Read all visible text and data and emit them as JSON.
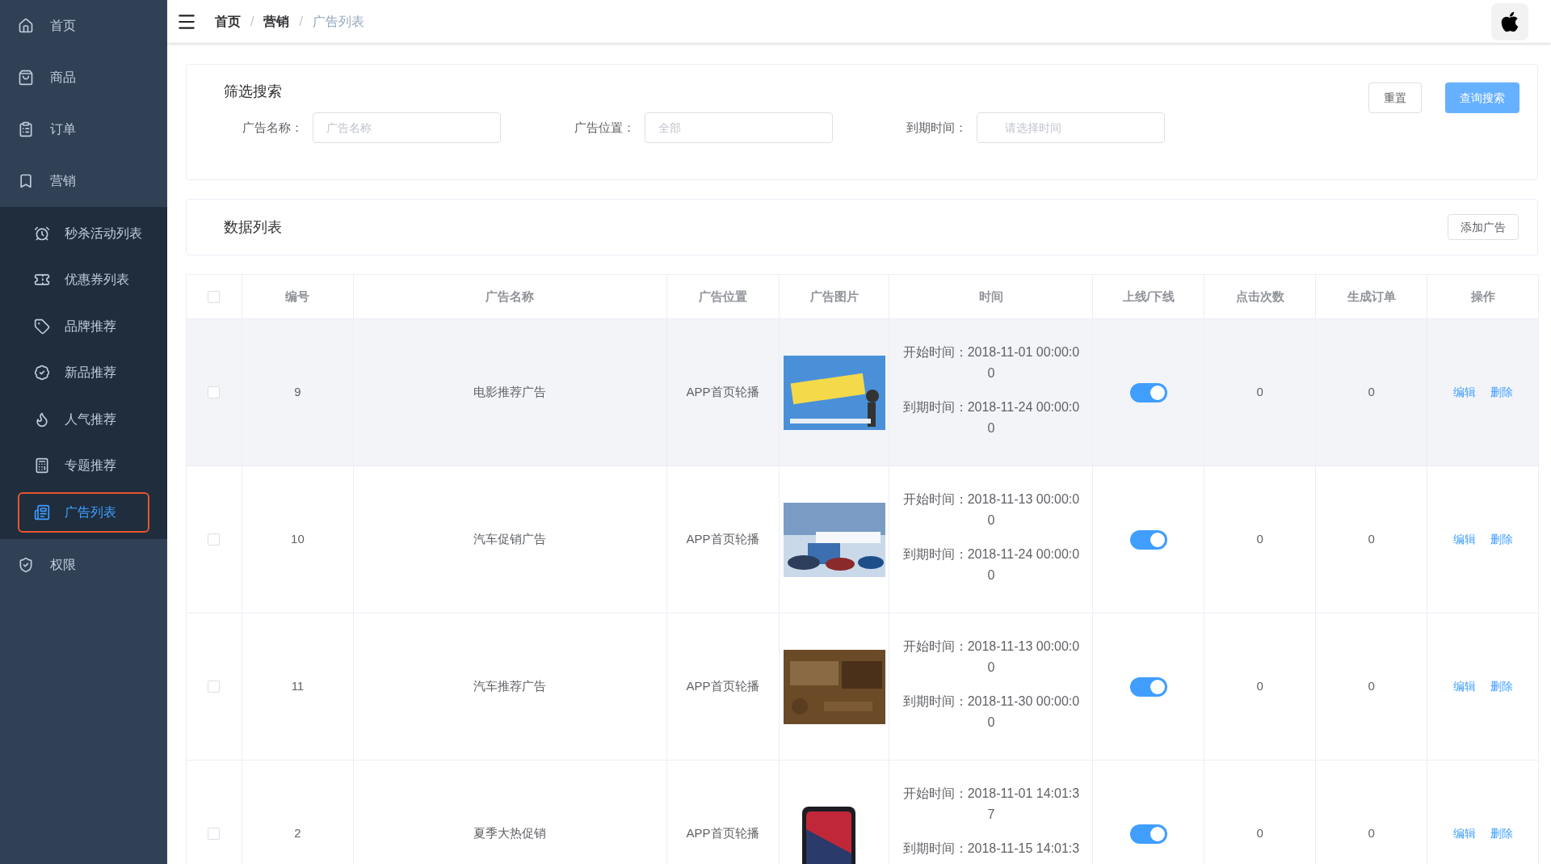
{
  "sidebar": {
    "items": [
      {
        "label": "首页",
        "kind": "home",
        "selected": false
      },
      {
        "label": "商品",
        "kind": "bag",
        "selected": false
      },
      {
        "label": "订单",
        "kind": "order",
        "selected": false
      },
      {
        "label": "营销",
        "kind": "mark",
        "selected": false,
        "expanded": true,
        "children": [
          {
            "label": "秒杀活动列表",
            "kind": "alarm",
            "selected": false
          },
          {
            "label": "优惠券列表",
            "kind": "ticket",
            "selected": false
          },
          {
            "label": "品牌推荐",
            "kind": "tag",
            "selected": false
          },
          {
            "label": "新品推荐",
            "kind": "new",
            "selected": false
          },
          {
            "label": "人气推荐",
            "kind": "flame",
            "selected": false
          },
          {
            "label": "专题推荐",
            "kind": "calc",
            "selected": false
          },
          {
            "label": "广告列表",
            "kind": "ad",
            "selected": true
          }
        ]
      },
      {
        "label": "权限",
        "kind": "shield",
        "selected": false
      }
    ]
  },
  "breadcrumb": [
    {
      "label": "首页",
      "kind": "link"
    },
    {
      "label": "/",
      "kind": "separator"
    },
    {
      "label": "营销",
      "kind": "link"
    },
    {
      "label": "/",
      "kind": "separator"
    },
    {
      "label": "广告列表",
      "kind": "current"
    }
  ],
  "filter": {
    "title": "筛选搜索",
    "reset": "重置",
    "search": "查询搜索",
    "fields": [
      {
        "label": "广告名称：",
        "placeholder": "广告名称"
      },
      {
        "label": "广告位置：",
        "placeholder": "全部"
      },
      {
        "label": "到期时间：",
        "placeholder": "请选择时间"
      }
    ]
  },
  "list": {
    "title": "数据列表",
    "add": "添加广告"
  },
  "table": {
    "select_all": {
      "checked": false
    },
    "columns": [
      "编号",
      "广告名称",
      "广告位置",
      "广告图片",
      "时间",
      "上线/下线",
      "点击次数",
      "生成订单",
      "操作"
    ],
    "rows": [
      {
        "checked": false,
        "hovered": true,
        "id": "9",
        "name": "电影推荐广告",
        "position": "APP首页轮播",
        "start": "开始时间：2018-11-01 00:00:00",
        "end": "到期时间：2018-11-24 00:00:00",
        "on": true,
        "clicks": "0",
        "orders": "0",
        "edit": "编辑",
        "delete": "删除"
      },
      {
        "checked": false,
        "hovered": false,
        "id": "10",
        "name": "汽车促销广告",
        "position": "APP首页轮播",
        "start": "开始时间：2018-11-13 00:00:00",
        "end": "到期时间：2018-11-24 00:00:00",
        "on": true,
        "clicks": "0",
        "orders": "0",
        "edit": "编辑",
        "delete": "删除"
      },
      {
        "checked": false,
        "hovered": false,
        "id": "11",
        "name": "汽车推荐广告",
        "position": "APP首页轮播",
        "start": "开始时间：2018-11-13 00:00:00",
        "end": "到期时间：2018-11-30 00:00:00",
        "on": true,
        "clicks": "0",
        "orders": "0",
        "edit": "编辑",
        "delete": "删除"
      },
      {
        "checked": false,
        "hovered": false,
        "id": "2",
        "name": "夏季大热促销",
        "position": "APP首页轮播",
        "start": "开始时间：2018-11-01 14:01:37",
        "end": "到期时间：2018-11-15 14:01:3",
        "on": true,
        "clicks": "0",
        "orders": "0",
        "edit": "编辑",
        "delete": "删除"
      }
    ]
  }
}
